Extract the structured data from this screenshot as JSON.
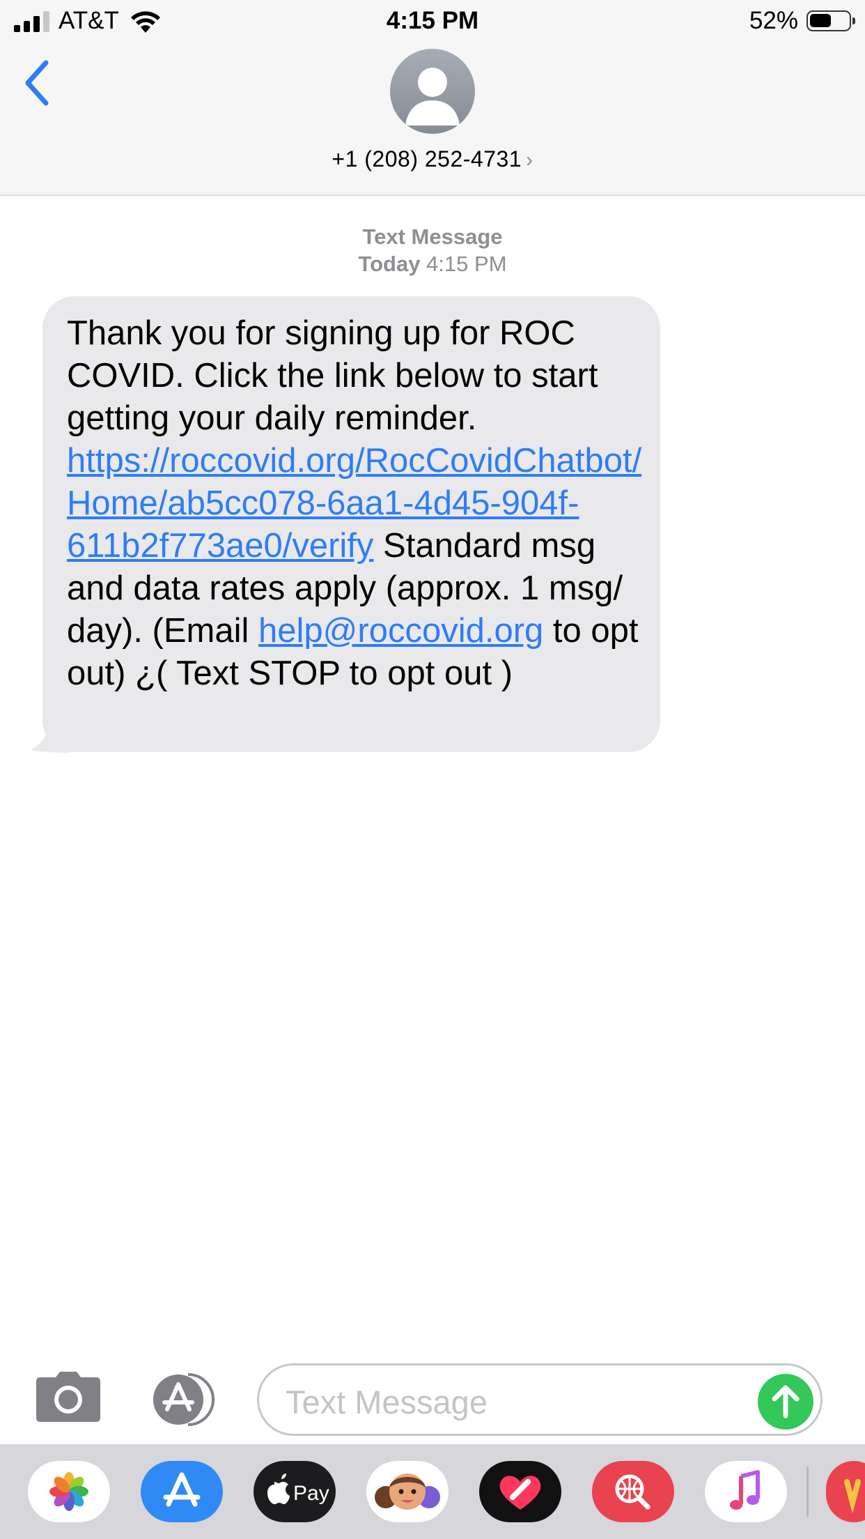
{
  "status_bar": {
    "carrier": "AT&T",
    "time": "4:15 PM",
    "battery": "52%"
  },
  "header": {
    "contact": "+1 (208) 252-4731",
    "chevron": "›"
  },
  "conversation": {
    "service": "Text Message",
    "day": "Today",
    "time": "4:15 PM",
    "message": {
      "part1": "Thank you for signing up for ROC COVID. Click the link below to start getting your daily reminder. ",
      "link1": "https://roccovid.org/RocCovidChatbot/Home/ab5cc078-6aa1-4d45-904f-611b2f773ae0/verify",
      "part2": "   Standard msg and data rates apply (approx. 1 msg/ day). (Email ",
      "link2": "help@roccovid.org",
      "part3": " to opt out) ¿( Text STOP to opt out )"
    }
  },
  "composer": {
    "placeholder": "Text Message"
  },
  "app_drawer": [
    {
      "name": "photos-app-icon",
      "color": "#ffffff"
    },
    {
      "name": "app-store-app-icon",
      "color": "#2f8af5"
    },
    {
      "name": "apple-pay-app-icon",
      "color": "#1c1c1e"
    },
    {
      "name": "memoji-app-icon",
      "color": "#ffffff"
    },
    {
      "name": "digital-touch-app-icon",
      "color": "#111111"
    },
    {
      "name": "images-search-app-icon",
      "color": "#e8434f"
    },
    {
      "name": "music-app-icon",
      "color": "#ffffff"
    }
  ],
  "apple_pay_label": "Pay",
  "colors": {
    "link": "#2f7cf6",
    "bubble": "#e9e9eb",
    "send": "#34c759",
    "accent": "#2f7cf6"
  }
}
